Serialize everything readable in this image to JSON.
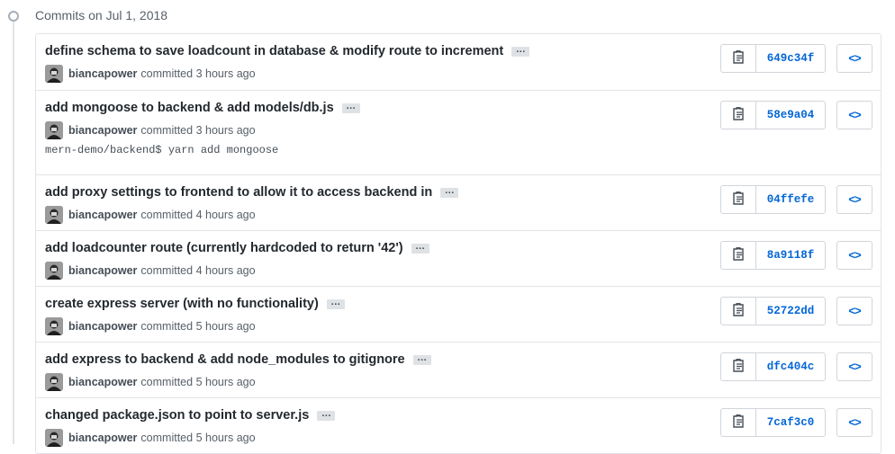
{
  "group": {
    "title": "Commits on Jul 1, 2018"
  },
  "commits": [
    {
      "message": "define schema to save loadcount in database & modify route to increment",
      "author": "biancapower",
      "action": "committed",
      "time": "3 hours ago",
      "sha": "649c34f",
      "description": ""
    },
    {
      "message": "add mongoose to backend & add models/db.js",
      "author": "biancapower",
      "action": "committed",
      "time": "3 hours ago",
      "sha": "58e9a04",
      "description": "mern-demo/backend$ yarn add mongoose"
    },
    {
      "message": "add proxy settings to frontend to allow it to access backend in",
      "author": "biancapower",
      "action": "committed",
      "time": "4 hours ago",
      "sha": "04ffefe",
      "description": ""
    },
    {
      "message": "add loadcounter route (currently hardcoded to return '42')",
      "author": "biancapower",
      "action": "committed",
      "time": "4 hours ago",
      "sha": "8a9118f",
      "description": ""
    },
    {
      "message": "create express server (with no functionality)",
      "author": "biancapower",
      "action": "committed",
      "time": "5 hours ago",
      "sha": "52722dd",
      "description": ""
    },
    {
      "message": "add express to backend & add node_modules to gitignore",
      "author": "biancapower",
      "action": "committed",
      "time": "5 hours ago",
      "sha": "dfc404c",
      "description": ""
    },
    {
      "message": "changed package.json to point to server.js",
      "author": "biancapower",
      "action": "committed",
      "time": "5 hours ago",
      "sha": "7caf3c0",
      "description": ""
    }
  ],
  "labels": {
    "ellipsis": "…",
    "browse": "<>"
  },
  "icons": {
    "copy": "clippy-icon",
    "browse": "code-icon",
    "timeline": "commit-icon"
  },
  "colors": {
    "link": "#0366d6",
    "border": "#e1e4e8",
    "muted": "#586069"
  }
}
